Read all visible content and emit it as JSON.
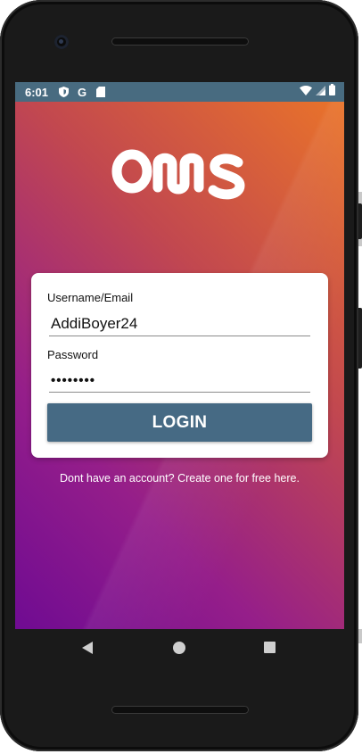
{
  "status_bar": {
    "time": "6:01",
    "left_icons": [
      "shield-icon",
      "google-icon",
      "sd-card-icon"
    ],
    "right_icons": [
      "wifi-icon",
      "cell-signal-icon",
      "battery-icon"
    ],
    "background_color": "#486b80"
  },
  "app": {
    "logo_text": "ONS",
    "gradient_colors": [
      "#ec7627",
      "#c2484f",
      "#951e8a",
      "#6f0b92"
    ]
  },
  "login_form": {
    "username_label": "Username/Email",
    "username_value": "AddiBoyer24",
    "password_label": "Password",
    "password_value": "••••••••",
    "login_button_label": "LOGIN",
    "button_color": "#466a84"
  },
  "signup_link_text": "Dont have an account? Create one for free here.",
  "nav_bar": {
    "buttons": [
      "back-icon",
      "home-icon",
      "recent-apps-icon"
    ]
  }
}
